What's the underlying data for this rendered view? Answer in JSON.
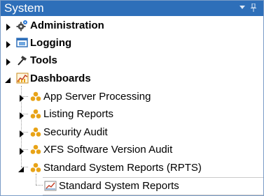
{
  "window": {
    "title": "System",
    "dropdown_icon": "dropdown-arrow-icon",
    "pin_icon": "pin-icon"
  },
  "tree": {
    "nodes": [
      {
        "label": "Administration",
        "icon": "gears-icon",
        "expanded": false,
        "level": 0
      },
      {
        "label": "Logging",
        "icon": "log-viewer-icon",
        "expanded": false,
        "level": 0
      },
      {
        "label": "Tools",
        "icon": "hammer-icon",
        "expanded": false,
        "level": 0
      },
      {
        "label": "Dashboards",
        "icon": "dashboard-chart-icon",
        "expanded": true,
        "level": 0
      },
      {
        "label": "App Server Processing",
        "icon": "dashboard-group-icon",
        "expanded": false,
        "level": 1
      },
      {
        "label": "Listing Reports",
        "icon": "dashboard-group-icon",
        "expanded": false,
        "level": 1
      },
      {
        "label": "Security Audit",
        "icon": "dashboard-group-icon",
        "expanded": false,
        "level": 1
      },
      {
        "label": "XFS Software Version Audit",
        "icon": "dashboard-group-icon",
        "expanded": false,
        "level": 1
      },
      {
        "label": "Standard System Reports (RPTS)",
        "icon": "dashboard-group-icon",
        "expanded": true,
        "level": 1
      },
      {
        "label": "Standard System Reports",
        "icon": "report-chart-icon",
        "expanded": false,
        "level": 2,
        "selected": true
      }
    ]
  },
  "colors": {
    "titlebar": "#2e6fb9",
    "group_icon": "#e8a317",
    "expander": "#000000"
  }
}
